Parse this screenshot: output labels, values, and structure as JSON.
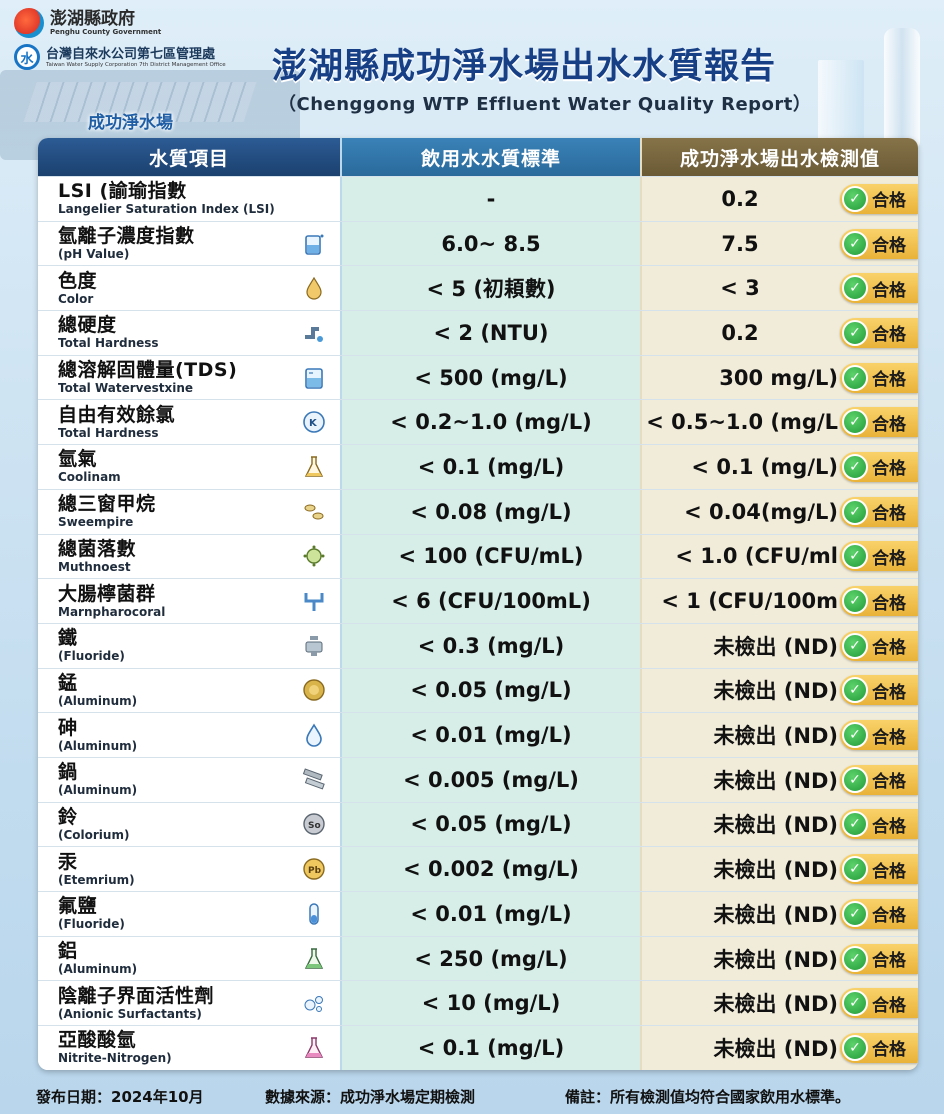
{
  "header": {
    "gov_name": "澎湖縣政府",
    "gov_name_en": "Penghu County Government",
    "org_name": "台灣自來水公司第七區管理處",
    "org_name_en": "Taiwan Water Supply Corporation 7th District Management Office",
    "plant_tag": "成功淨水場",
    "title": "澎湖縣成功淨水場出水水質報告",
    "subtitle": "（Chenggong WTP Effluent Water Quality Report）"
  },
  "table": {
    "headers": [
      "水質項目",
      "飲用水水質標準",
      "成功淨水場出水檢測值"
    ],
    "pass_label": "合格",
    "rows": [
      {
        "zh": "LSI (諭瑜指數",
        "en": "Langelier Saturation Index (LSI)",
        "std": "-",
        "val": "0.2",
        "icon": "none-icon",
        "align": "center"
      },
      {
        "zh": "氫離子濃度指數",
        "en": "(pH Value)",
        "std": "6.0~ 8.5",
        "val": "7.5",
        "icon": "beaker-icon",
        "align": "center"
      },
      {
        "zh": "色度",
        "en": "Color",
        "std": "< 5 (初頛數)",
        "val": "< 3",
        "icon": "drop-icon",
        "align": "center"
      },
      {
        "zh": "總硬度",
        "en": "Total Hardness",
        "std": "< 2 (NTU)",
        "val": "0.2",
        "icon": "pipe-icon",
        "align": "center"
      },
      {
        "zh": "總溶解固體量(TDS)",
        "en": "Total Watervestxine",
        "std": "< 500 (mg/L)",
        "val": "300 mg/L)",
        "icon": "measuring-cup-icon",
        "align": "right"
      },
      {
        "zh": "自由有效餘氯",
        "en": "Total Hardness",
        "std": "< 0.2~1.0 (mg/L)",
        "val": "< 0.5~1.0 (mg/L",
        "icon": "k2-icon",
        "align": "right"
      },
      {
        "zh": "氫氣",
        "en": "Coolinam",
        "std": "< 0.1 (mg/L)",
        "val": "< 0.1 (mg/L)",
        "icon": "flask-icon",
        "align": "right"
      },
      {
        "zh": "總三窗甲烷",
        "en": "Sweempire",
        "std": "< 0.08 (mg/L)",
        "val": "< 0.04(mg/L)",
        "icon": "bacteria-icon",
        "align": "right"
      },
      {
        "zh": "總菌落數",
        "en": "Muthnoest",
        "std": "< 100 (CFU/mL)",
        "val": "< 1.0 (CFU/ml",
        "icon": "virus-icon",
        "align": "right"
      },
      {
        "zh": "大腸檸菌群",
        "en": "Marnpharocoral",
        "std": "< 6 (CFU/100mL)",
        "val": "< 1 (CFU/100m",
        "icon": "pipes-icon",
        "align": "right"
      },
      {
        "zh": "鐵",
        "en": "(Fluoride)",
        "std": "< 0.3 (mg/L)",
        "val": "未檢出 (ND)",
        "icon": "valve-icon",
        "align": "right"
      },
      {
        "zh": "錳",
        "en": "(Aluminum)",
        "std": "< 0.05 (mg/L)",
        "val": "未檢出 (ND)",
        "icon": "gold-coin-icon",
        "align": "right"
      },
      {
        "zh": "砷",
        "en": "(Aluminum)",
        "std": "< 0.01 (mg/L)",
        "val": "未檢出 (ND)",
        "icon": "drop-outline-icon",
        "align": "right"
      },
      {
        "zh": "鍋",
        "en": "(Aluminum)",
        "std": "< 0.005 (mg/L)",
        "val": "未檢出 (ND)",
        "icon": "metal-bars-icon",
        "align": "right"
      },
      {
        "zh": "鈴",
        "en": "(Colorium)",
        "std": "< 0.05 (mg/L)",
        "val": "未檢出 (ND)",
        "icon": "silver-coin-icon",
        "align": "right"
      },
      {
        "zh": "汞",
        "en": "(Etemrium)",
        "std": "< 0.002 (mg/L)",
        "val": "未檢出 (ND)",
        "icon": "yellow-coin-icon",
        "align": "right"
      },
      {
        "zh": "氟鹽",
        "en": "(Fluoride)",
        "std": "< 0.01 (mg/L)",
        "val": "未檢出 (ND)",
        "icon": "test-tube-icon",
        "align": "right"
      },
      {
        "zh": "鋁",
        "en": "(Aluminum)",
        "std": "< 250 (mg/L)",
        "val": "未檢出 (ND)",
        "icon": "flask-green-icon",
        "align": "right"
      },
      {
        "zh": "陰離子界面活性劑",
        "en": "(Anionic Surfactants)",
        "std": "< 10 (mg/L)",
        "val": "未檢出 (ND)",
        "icon": "bubbles-icon",
        "align": "right"
      },
      {
        "zh": "亞酸酸氫",
        "en": "Nitrite-Nitrogen)",
        "std": "< 0.1 (mg/L)",
        "val": "未檢出 (ND)",
        "icon": "flask-pink-icon",
        "align": "right"
      }
    ]
  },
  "footer": {
    "date": "發布日期：2024年10月",
    "source": "數據來源：成功淨水場定期檢測",
    "note": "備註：所有檢測值均符合國家飲用水標準。"
  },
  "colors": {
    "title": "#173f86",
    "header_item": "#1b416f",
    "header_std": "#2a6a9b",
    "header_val": "#6a5a35",
    "std_cell": "#d6ede8",
    "val_cell": "#f1ecda",
    "badge": "#e9b238",
    "check": "#219a37"
  }
}
